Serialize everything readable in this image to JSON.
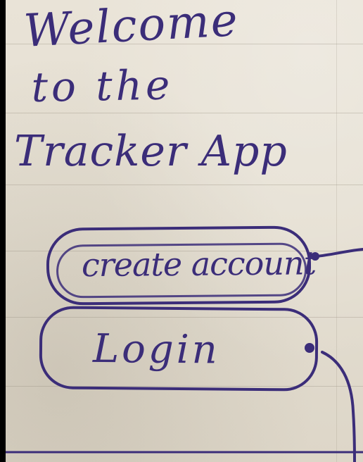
{
  "sketch": {
    "title_line_1": "Welcome",
    "title_line_2": "to the",
    "title_line_3": "Tracker App",
    "buttons": {
      "create_account": "create account",
      "login": "Login"
    },
    "colors": {
      "ink": "#3b2d79",
      "paper": "#e6e0d4",
      "background": "#000000"
    }
  }
}
